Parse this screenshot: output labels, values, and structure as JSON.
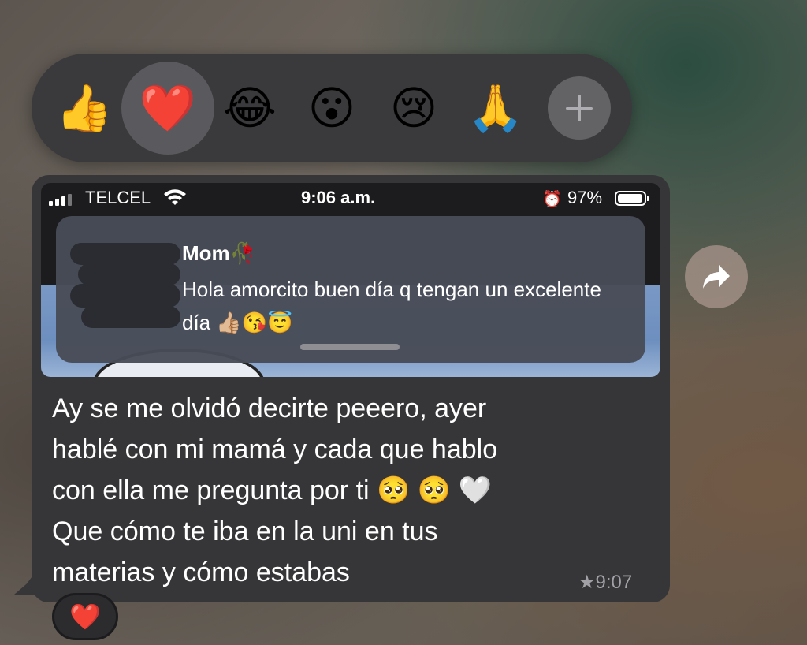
{
  "reaction_bar": {
    "reactions": [
      {
        "emoji": "👍",
        "name": "thumbs-up"
      },
      {
        "emoji": "❤️",
        "name": "red-heart",
        "selected": true
      },
      {
        "emoji": "😂",
        "name": "joy"
      },
      {
        "emoji": "😮",
        "name": "surprised"
      },
      {
        "emoji": "😢",
        "name": "cry"
      },
      {
        "emoji": "🙏",
        "name": "pray"
      }
    ],
    "more_icon": "plus-icon"
  },
  "screenshot": {
    "status_bar": {
      "carrier": "TELCEL",
      "time": "9:06 a.m.",
      "alarm_icon": "⏰",
      "battery_percent": "97%",
      "battery_level": 0.97
    },
    "notification": {
      "title": "Mom🥀",
      "body": "Hola amorcito buen día q tengan un excelente día 👍🏼😘😇"
    }
  },
  "message": {
    "text_lines": [
      "Ay se me olvidó decirte peeero, ayer",
      "hablé con mi mamá y cada que hablo",
      "con ella me pregunta por ti 🥺 🥺 🤍",
      "Que cómo te iba en la uni en tus",
      "materias y cómo estabas"
    ],
    "meta": "★9:07",
    "reaction": "❤️"
  },
  "forward_icon": "share-arrow-icon"
}
